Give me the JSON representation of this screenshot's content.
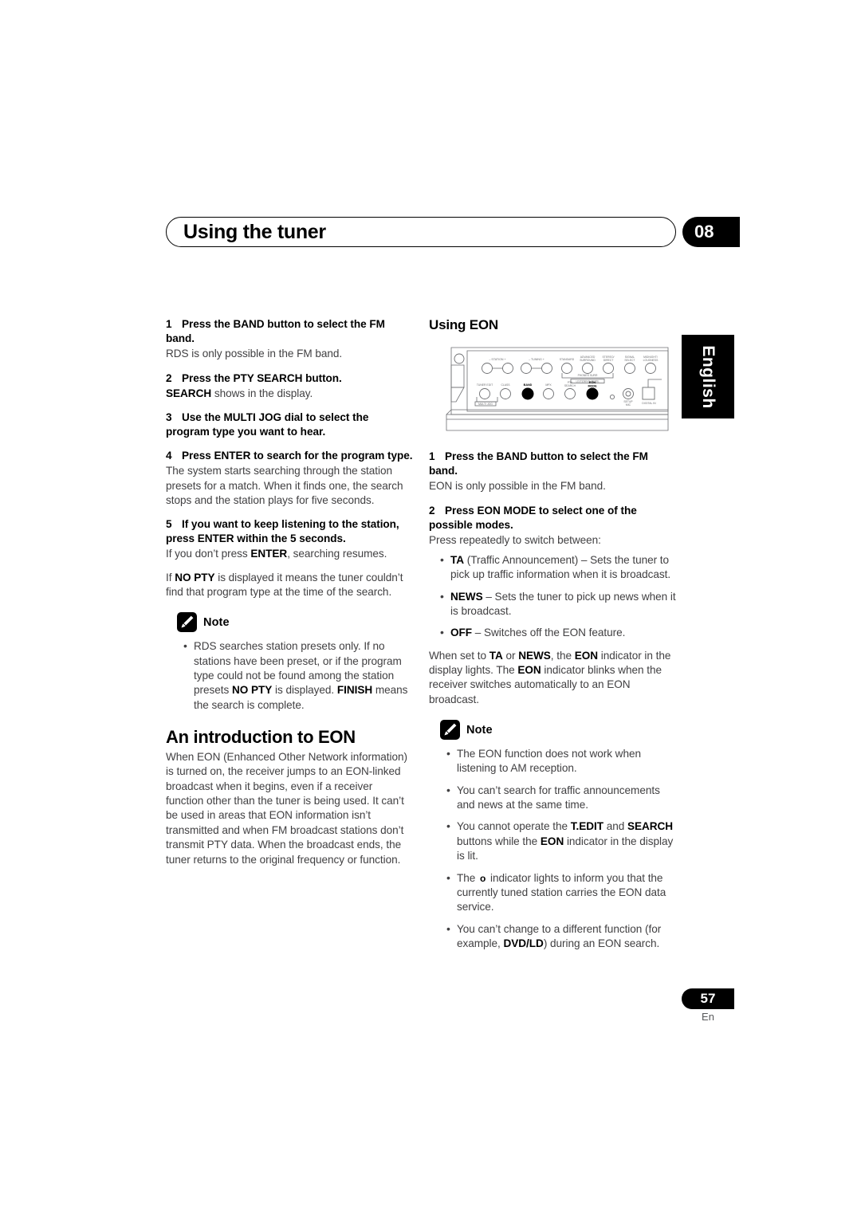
{
  "header": {
    "title": "Using the tuner",
    "chapter": "08"
  },
  "side_tab": {
    "language": "English"
  },
  "footer": {
    "page_number": "57",
    "language_code": "En"
  },
  "left_column": {
    "steps": [
      {
        "num": "1",
        "text": "Press the BAND button to select the FM band.",
        "body": "RDS is only possible in the FM band."
      },
      {
        "num": "2",
        "text": "Press the PTY SEARCH button.",
        "body_prefix_bold": "SEARCH",
        "body_rest": " shows in the display."
      },
      {
        "num": "3",
        "text": "Use the MULTI JOG dial to select the program type you want to hear.",
        "body": ""
      },
      {
        "num": "4",
        "text": "Press ENTER to search for the program type.",
        "body": "The system starts searching through the station presets for a match. When it finds one, the search stops and the station plays for five seconds."
      },
      {
        "num": "5",
        "text": "If you want to keep listening to the station, press ENTER within the 5 seconds."
      }
    ],
    "step5_body_a_pre": "If you don’t press ",
    "step5_body_a_bold": "ENTER",
    "step5_body_a_post": ", searching resumes.",
    "step5_body_b_pre": "If ",
    "step5_body_b_bold": "NO PTY",
    "step5_body_b_post": " is displayed it means the tuner couldn’t find that program type at the time of the search.",
    "note": {
      "label": "Note",
      "bullets": [
        {
          "p1": "RDS searches station presets only. If no stations have been preset, or if the program type could not be found among the station presets ",
          "b1": "NO PTY",
          "p2": " is displayed. ",
          "b2": "FINISH",
          "p3": " means the search is complete."
        }
      ]
    },
    "section": {
      "title": "An introduction to EON",
      "body": "When EON (Enhanced Other Network information) is turned on, the receiver jumps to an EON-linked broadcast when it begins, even if a receiver function other than the tuner is being used. It can’t be used in areas that EON information isn’t transmitted and when FM broadcast stations don’t transmit PTY data. When the broadcast ends, the tuner returns to the original frequency or function."
    }
  },
  "right_column": {
    "subsection_title": "Using EON",
    "device_panel": {
      "labels": [
        "STATION",
        "TUNING",
        "STANDARD",
        "ADVANCED SURROUND",
        "STEREO/ DIRECT",
        "SIGNAL SELECT",
        "MIDNIGHT/ LOUDNESS",
        "PHONES SURR",
        "LISTENING MODE",
        "TUNER EDIT",
        "CLASS",
        "BAND",
        "MPX",
        "PTY SEARCH",
        "EON MODE",
        "SETUP MIC",
        "DIGITAL IN",
        "MULTI JOG"
      ],
      "highlighted_buttons": [
        "BAND",
        "EON MODE"
      ]
    },
    "steps": [
      {
        "num": "1",
        "text": "Press the BAND button to select the FM band.",
        "body": "EON is only possible in the FM band."
      },
      {
        "num": "2",
        "text": "Press EON MODE to select one of the possible modes.",
        "body": "Press repeatedly to switch between:"
      }
    ],
    "mode_bullets": [
      {
        "bold": "TA",
        "rest": " (Traffic Announcement) – Sets the tuner to pick up traffic information when it is broadcast."
      },
      {
        "bold": "NEWS",
        "rest": " – Sets the tuner to pick up news when it is broadcast."
      },
      {
        "bold": "OFF",
        "rest": " – Switches off the EON feature."
      }
    ],
    "eon_paragraph": {
      "p1": "When set to ",
      "b1": "TA",
      "p2": " or ",
      "b2": "NEWS",
      "p3": ", the ",
      "b3": "EON",
      "p4": " indicator in the display lights. The ",
      "b4": "EON",
      "p5": " indicator blinks when the receiver switches automatically to an EON broadcast."
    },
    "note": {
      "label": "Note",
      "bullets": [
        {
          "text": "The EON function does not work when listening to AM reception."
        },
        {
          "text": "You can’t search for traffic announcements and news at the same time."
        },
        {
          "p1": "You cannot operate the ",
          "b1": "T.EDIT",
          "p2": " and ",
          "b2": "SEARCH",
          "p3": " buttons while the ",
          "b3": "EON",
          "p4": " indicator in the display is lit."
        },
        {
          "p1": "The ",
          "glyph": "o",
          "p2": " indicator lights to inform you that the currently tuned station carries the EON data service."
        },
        {
          "p1": "You can’t change to a different function (for example, ",
          "b1": "DVD/LD",
          "p2": ") during an EON search."
        }
      ]
    }
  }
}
